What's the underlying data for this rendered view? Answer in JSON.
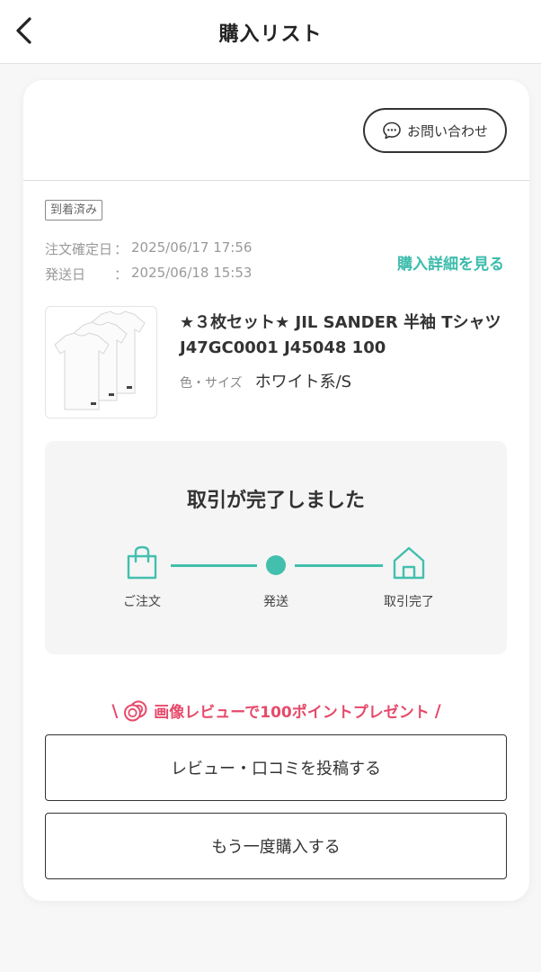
{
  "header": {
    "title": "購入リスト"
  },
  "order": {
    "inquiry_label": "お問い合わせ",
    "status": "到着済み",
    "confirmed_label": "注文確定日",
    "confirmed_value": "2025/06/17 17:56",
    "shipped_label": "発送日",
    "shipped_value": "2025/06/18 15:53",
    "detail_link": "購入詳細を見る"
  },
  "product": {
    "name": "★３枚セット★ JIL SANDER 半袖 Tシャツ J47GC0001 J45048 100",
    "spec_label": "色・サイズ",
    "spec_value": "ホワイト系/S"
  },
  "progress": {
    "title": "取引が完了しました",
    "steps": [
      {
        "label": "ご注文",
        "icon": "shopping-bag-icon"
      },
      {
        "label": "発送",
        "icon": "dot-icon"
      },
      {
        "label": "取引完了",
        "icon": "house-icon"
      }
    ],
    "accent_color": "#43bfad"
  },
  "promo": {
    "text": "画像レビューで100ポイントプレゼント",
    "color": "#e64a6a"
  },
  "actions": {
    "review_label": "レビュー・口コミを投稿する",
    "rebuy_label": "もう一度購入する"
  }
}
